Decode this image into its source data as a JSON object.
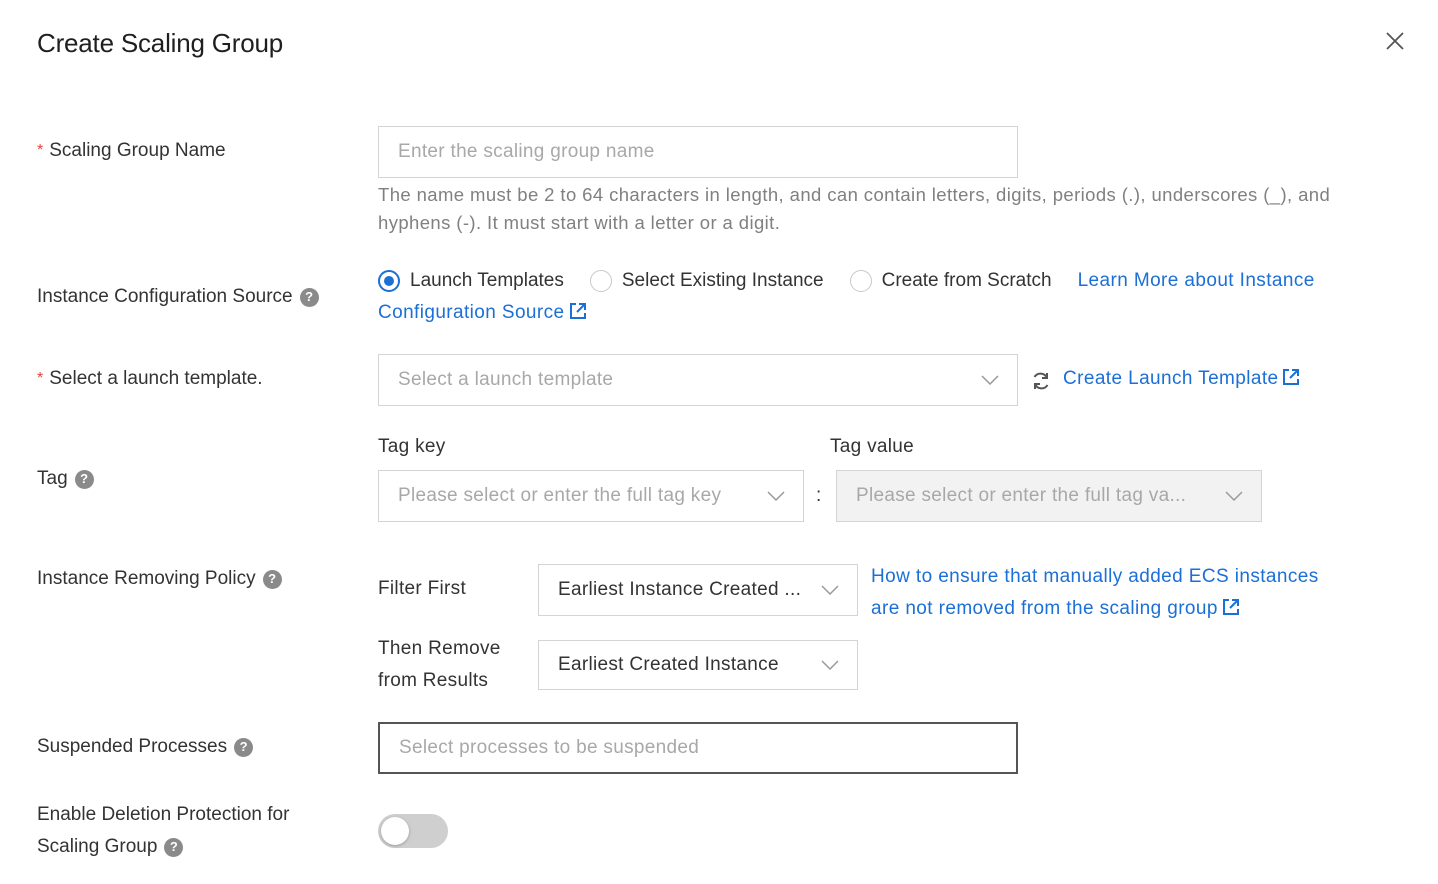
{
  "dialog": {
    "title": "Create Scaling Group",
    "close_icon": "close-icon"
  },
  "form": {
    "group_name": {
      "label": "Scaling Group Name",
      "required_mark": "*",
      "placeholder": "Enter the scaling group name",
      "value": "",
      "hint": "The name must be 2 to 64 characters in length, and can contain letters, digits, periods (.), underscores (_), and hyphens (-). It must start with a letter or a digit."
    },
    "config_source": {
      "label": "Instance Configuration Source",
      "options": [
        "Launch Templates",
        "Select Existing Instance",
        "Create from Scratch"
      ],
      "selected": "Launch Templates",
      "learn_more_line1": "Learn More about Instance",
      "learn_more_line2": "Configuration Source"
    },
    "launch_template": {
      "label": "Select a launch template.",
      "required_mark": "*",
      "placeholder": "Select a launch template",
      "create_link": "Create Launch Template"
    },
    "tag": {
      "label": "Tag",
      "key_label": "Tag key",
      "value_label": "Tag value",
      "key_placeholder": "Please select or enter the full tag key",
      "separator": ":",
      "value_placeholder": "Please select or enter the full tag va..."
    },
    "removing_policy": {
      "label": "Instance Removing Policy",
      "filter_first_label": "Filter First",
      "filter_first_value": "Earliest Instance Created ...",
      "then_remove_label_line1": "Then Remove",
      "then_remove_label_line2": "from Results",
      "then_remove_value": "Earliest Created Instance",
      "help_link_line1": "How to ensure that manually added ECS instances",
      "help_link_line2": "are not removed from the scaling group"
    },
    "suspended_processes": {
      "label": "Suspended Processes",
      "placeholder": "Select processes to be suspended"
    },
    "deletion_protection": {
      "label_line1": "Enable Deletion Protection for",
      "label_line2": "Scaling Group",
      "enabled": false
    }
  },
  "colors": {
    "link": "#1b6fd6",
    "required": "#e5423b",
    "placeholder": "#a8a8a8",
    "toggle_off": "#cfcfcf"
  }
}
